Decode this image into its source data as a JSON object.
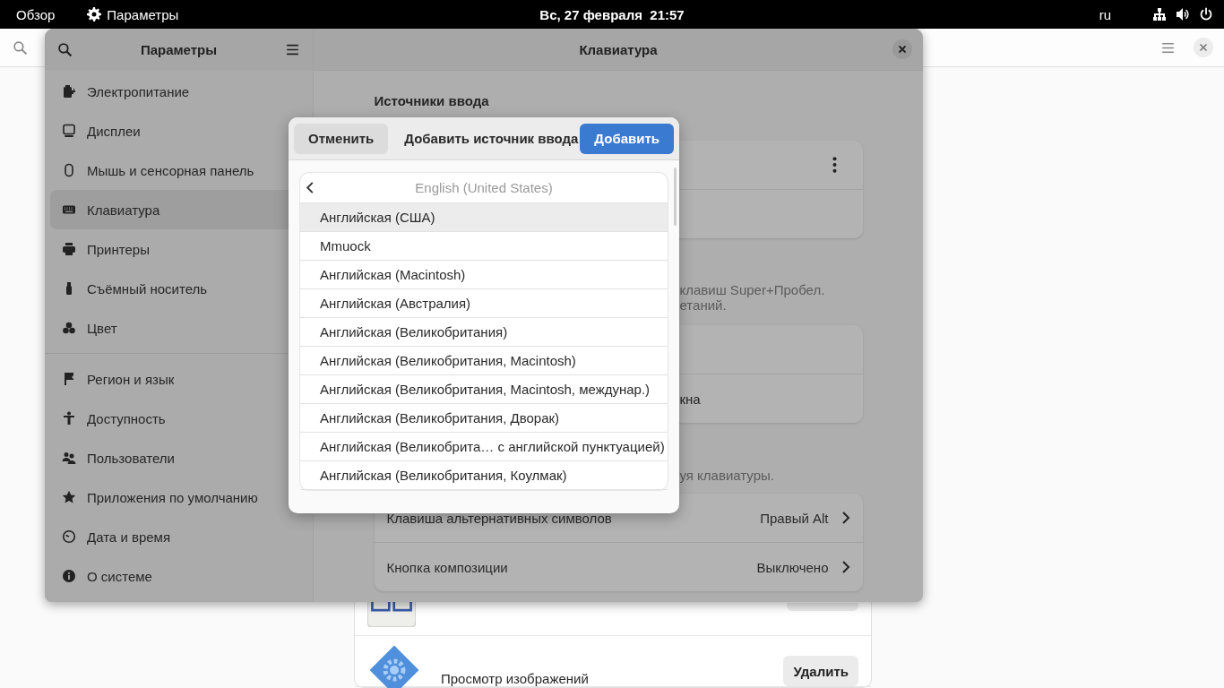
{
  "top_bar": {
    "activities": "Обзор",
    "app_menu": "Параметры",
    "clock": "Вс, 27 февраля  21:57",
    "keyboard_layout": "ru"
  },
  "background_window": {
    "app_rows": [
      {
        "kind": "keyboard"
      },
      {
        "kind": "viewer",
        "name": "Просмотр изображений",
        "button": "Удалить"
      }
    ]
  },
  "settings_window": {
    "sidebar_title": "Параметры",
    "page_title": "Клавиатура",
    "sidebar_groups": [
      [
        {
          "kind": "power",
          "label": "Электропитание",
          "selected": false
        },
        {
          "kind": "display",
          "label": "Дисплеи",
          "selected": false
        },
        {
          "kind": "mouse",
          "label": "Мышь и сенсорная панель",
          "selected": false
        },
        {
          "kind": "keyboard",
          "label": "Клавиатура",
          "selected": true
        },
        {
          "kind": "printer",
          "label": "Принтеры",
          "selected": false
        },
        {
          "kind": "usb",
          "label": "Съёмный носитель",
          "selected": false
        },
        {
          "kind": "color",
          "label": "Цвет",
          "selected": false
        }
      ],
      [
        {
          "kind": "flag",
          "label": "Регион и язык",
          "selected": false
        },
        {
          "kind": "access",
          "label": "Доступность",
          "selected": false
        },
        {
          "kind": "users",
          "label": "Пользователи",
          "selected": false
        },
        {
          "kind": "star",
          "label": "Приложения по умолчанию",
          "selected": false
        },
        {
          "kind": "clock",
          "label": "Дата и время",
          "selected": false
        },
        {
          "kind": "info",
          "label": "О системе",
          "selected": false
        }
      ]
    ],
    "input_sources_heading": "Источники ввода",
    "switching_note": [
      "клавиш Super+Пробел.",
      "етаний."
    ],
    "window_row_fragment": "кна",
    "special_keys_note": "уя клавиатуры.",
    "special_keys": [
      {
        "label": "Клавиша альтернативных символов",
        "value": "Правый Alt"
      },
      {
        "label": "Кнопка композиции",
        "value": "Выключено"
      }
    ]
  },
  "dialog": {
    "cancel": "Отменить",
    "title": "Добавить источник ввода",
    "add": "Добавить",
    "language": "English (United States)",
    "layouts": [
      {
        "label": "Английская (США)",
        "selected": true
      },
      {
        "label": "Mmuock",
        "selected": false
      },
      {
        "label": "Английская (Macintosh)",
        "selected": false
      },
      {
        "label": "Английская (Австралия)",
        "selected": false
      },
      {
        "label": "Английская (Великобритания)",
        "selected": false
      },
      {
        "label": "Английская (Великобритания, Macintosh)",
        "selected": false
      },
      {
        "label": "Английская (Великобритания, Macintosh, междунар.)",
        "selected": false
      },
      {
        "label": "Английская (Великобритания, Дворак)",
        "selected": false
      },
      {
        "label": "Английская (Великобрита… с английской пунктуацией)",
        "selected": false
      },
      {
        "label": "Английская (Великобритания, Коулмак)",
        "selected": false
      }
    ]
  }
}
